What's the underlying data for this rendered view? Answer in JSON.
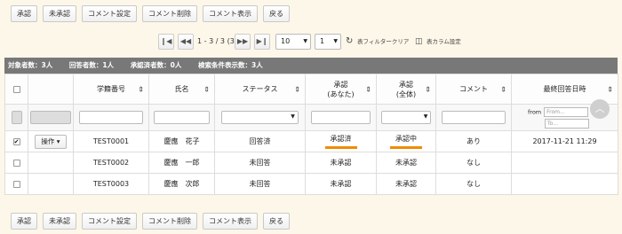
{
  "toolbar": {
    "buttons": [
      "承認",
      "未承認",
      "コメント設定",
      "コメント削除",
      "コメント表示",
      "戻る"
    ]
  },
  "pager": {
    "first": "❙◀",
    "prev": "◀◀",
    "info": "1 - 3 / 3 (3)",
    "next": "▶▶",
    "last": "▶❙",
    "per_page": "10",
    "page": "1",
    "filter_clear": "表フィルタークリア",
    "column_settings": "表カラム設定"
  },
  "stats": {
    "target": "対象者数：3人",
    "answered": "回答者数：1人",
    "approved": "承認済者数：0人",
    "display": "検索条件表示数：3人"
  },
  "table": {
    "headers": {
      "student_no": "学籍番号",
      "name": "氏名",
      "status": "ステータス",
      "approval_you_1": "承認",
      "approval_you_2": "(あなた)",
      "approval_all_1": "承認",
      "approval_all_2": "(全体)",
      "comment": "コメント",
      "last_answer": "最終回答日時"
    },
    "filter": {
      "from_label": "from",
      "from_placeholder": "From...",
      "to_placeholder": "To..."
    },
    "op_button": "操作 ▾",
    "rows": [
      {
        "checked": true,
        "student_no": "TEST0001",
        "name": "慶應　花子",
        "status": "回答済",
        "approval_you": "承認済",
        "approval_all": "承認中",
        "comment": "あり",
        "last_answer": "2017-11-21 11:29"
      },
      {
        "checked": false,
        "student_no": "TEST0002",
        "name": "慶應　一郎",
        "status": "未回答",
        "approval_you": "未承認",
        "approval_all": "未承認",
        "comment": "なし",
        "last_answer": ""
      },
      {
        "checked": false,
        "student_no": "TEST0003",
        "name": "慶應　次郎",
        "status": "未回答",
        "approval_you": "未承認",
        "approval_all": "未承認",
        "comment": "なし",
        "last_answer": ""
      }
    ]
  },
  "colors": {
    "stats_bar": "#787878",
    "highlight_underline": "#f08c00",
    "background": "#fdf7e9"
  }
}
